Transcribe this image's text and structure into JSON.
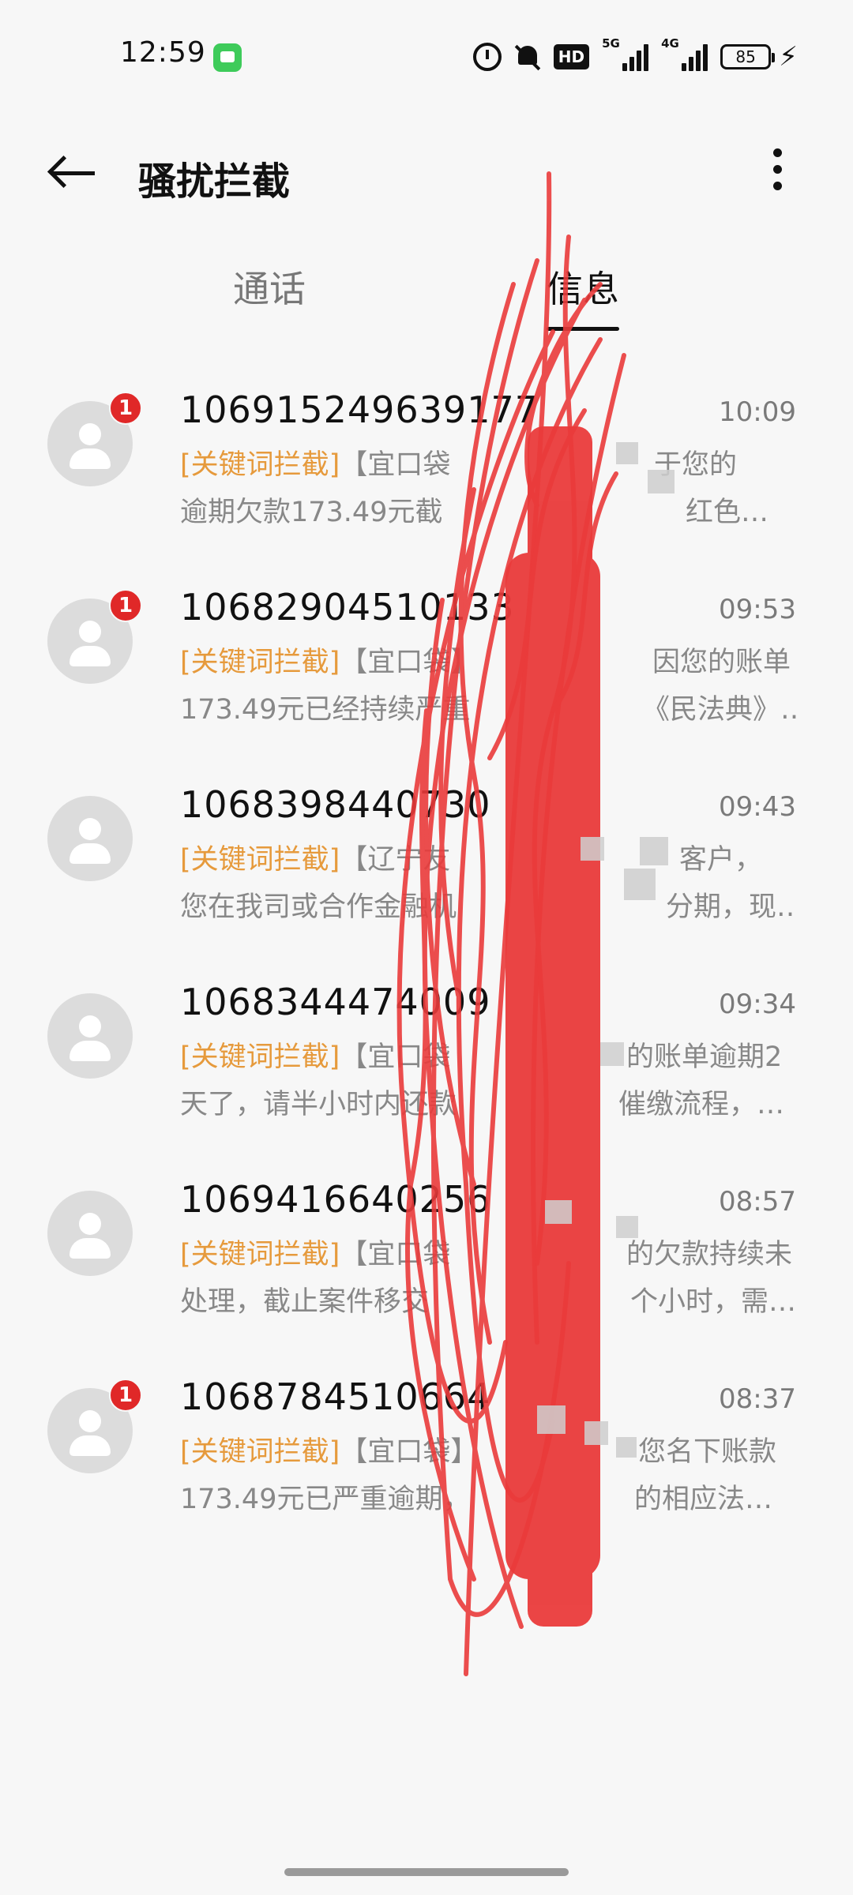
{
  "status_bar": {
    "time": "12:59",
    "hd_label": "HD",
    "net1_label": "5G",
    "net2_label": "4G",
    "battery": "85",
    "charge_glyph": "⚡",
    "icons": [
      "messages-app-icon",
      "alarm-icon",
      "mute-bell-icon",
      "hd-icon",
      "5g-signal-icon",
      "4g-signal-icon",
      "battery-icon",
      "charging-icon"
    ]
  },
  "header": {
    "title": "骚扰拦截",
    "back_icon": "back-arrow-icon",
    "more_icon": "more-vertical-icon"
  },
  "tabs": {
    "calls": "通话",
    "messages": "信息",
    "active": "messages"
  },
  "messages": [
    {
      "sender": "106915249639177",
      "time": "10:09",
      "unread": "1",
      "tag": "[关键词拦截]",
      "line1": "【宜口袋",
      "line1_end": "于您的",
      "line2": "逾期欠款173.49元截",
      "line2_end": "红色…"
    },
    {
      "sender": "10682904510133",
      "time": "09:53",
      "unread": "1",
      "tag": "[关键词拦截]",
      "line1": "【宜口袋】",
      "line1_end": "因您的账单",
      "line2": "173.49元已经持续严重",
      "line2_end": "《民法典》…"
    },
    {
      "sender": "1068398440730",
      "time": "09:43",
      "unread": "",
      "tag": "[关键词拦截]",
      "line1": "【辽宁友",
      "line1_end": "客户，",
      "line2": "您在我司或合作金融机",
      "line2_end": "分期，现…"
    },
    {
      "sender": "1068344474009",
      "time": "09:34",
      "unread": "",
      "tag": "[关键词拦截]",
      "line1": "【宜口袋",
      "line1_end": "的账单逾期2",
      "line2": "天了，请半小时内还款",
      "line2_end": "催缴流程，…"
    },
    {
      "sender": "1069416640256",
      "time": "08:57",
      "unread": "",
      "tag": "[关键词拦截]",
      "line1": "【宜口袋",
      "line1_end": "的欠款持续未",
      "line2": "处理，截止案件移交",
      "line2_end": "个小时，需…"
    },
    {
      "sender": "1068784510664",
      "time": "08:37",
      "unread": "1",
      "tag": "[关键词拦截]",
      "line1": "【宜口袋】",
      "line1_end": "您名下账款",
      "line2": "173.49元已严重逾期，",
      "line2_end": "的相应法…"
    }
  ],
  "colors": {
    "background": "#f7f7f7",
    "tag_orange": "#e69a3c",
    "badge_red": "#e02828",
    "scribble_red": "#ea3b3b"
  }
}
